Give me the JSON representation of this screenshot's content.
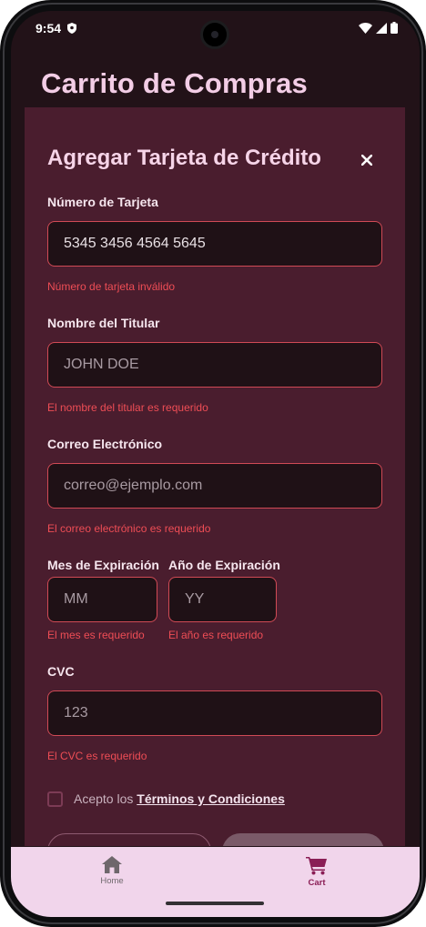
{
  "status_bar": {
    "time": "9:54"
  },
  "app_bar": {
    "title": "Carrito de Compras"
  },
  "dialog": {
    "title": "Agregar Tarjeta de Crédito",
    "close_symbol": "×",
    "fields": {
      "card_number": {
        "label": "Número de Tarjeta",
        "value": "5345 3456 4564 5645",
        "error": "Número de tarjeta inválido"
      },
      "holder_name": {
        "label": "Nombre del Titular",
        "placeholder": "JOHN DOE",
        "error": "El nombre del titular es requerido"
      },
      "email": {
        "label": "Correo Electrónico",
        "placeholder": "correo@ejemplo.com",
        "error": "El correo electrónico es requerido"
      },
      "exp_month": {
        "label": "Mes de Expiración",
        "placeholder": "MM",
        "error": "El mes es requerido"
      },
      "exp_year": {
        "label": "Año de Expiración",
        "placeholder": "YY",
        "error": "El año es requerido"
      },
      "cvc": {
        "label": "CVC",
        "placeholder": "123",
        "error": "El CVC es requerido"
      }
    },
    "terms": {
      "prefix": "Acepto los ",
      "link": "Términos y Condiciones",
      "checked": false
    }
  },
  "bottom_nav": {
    "items": [
      {
        "label": "Home",
        "icon": "home-icon",
        "active": false
      },
      {
        "label": "Cart",
        "icon": "cart-icon",
        "active": true
      }
    ]
  },
  "colors": {
    "dialog_bg": "#4a1d2e",
    "error": "#ee4d55",
    "title": "#f6d4e8",
    "nav_bg": "#f1d5eb",
    "nav_active": "#8a1e55"
  }
}
